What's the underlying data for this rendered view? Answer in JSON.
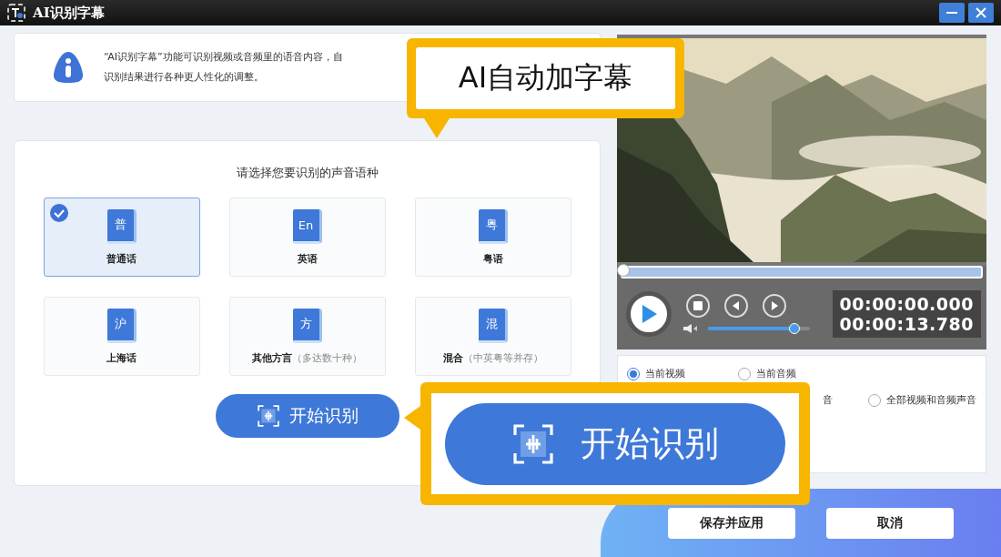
{
  "window": {
    "title": "AI识别字幕"
  },
  "info": {
    "lines": [
      "“AI识别字幕”功能可识别视频或音频里的语音内容，自",
      "识别结果进行各种更人性化的调整。"
    ]
  },
  "language_panel": {
    "heading": "请选择您要识别的声音语种",
    "languages": [
      {
        "glyph": "普",
        "label": "普通话",
        "selected": true
      },
      {
        "glyph": "En",
        "label": "英语",
        "selected": false
      },
      {
        "glyph": "粤",
        "label": "粤语",
        "selected": false
      },
      {
        "glyph": "沪",
        "label": "上海话",
        "selected": false
      },
      {
        "glyph": "方",
        "label": "其他方言",
        "note": "（多达数十种）",
        "selected": false
      },
      {
        "glyph": "混",
        "label": "混合",
        "note": "（中英粤等并存）",
        "selected": false
      }
    ],
    "start_button": "开始识别"
  },
  "player": {
    "progress": {
      "level": 0
    },
    "volume": {
      "level": 0.85
    },
    "time_current": "00:00:00.000",
    "time_total": "00:00:13.780"
  },
  "source_options": [
    [
      {
        "label": "当前视频",
        "selected": true
      },
      {
        "label": "当前音频",
        "selected": false
      }
    ],
    [
      {
        "label": "全部视频和音频声音",
        "selected": false
      }
    ]
  ],
  "covered_option_text": "音",
  "buttons": {
    "save": "保存并应用",
    "cancel": "取消"
  },
  "callouts": {
    "top": "AI自动加字幕",
    "bottom_button": "开始识别"
  }
}
